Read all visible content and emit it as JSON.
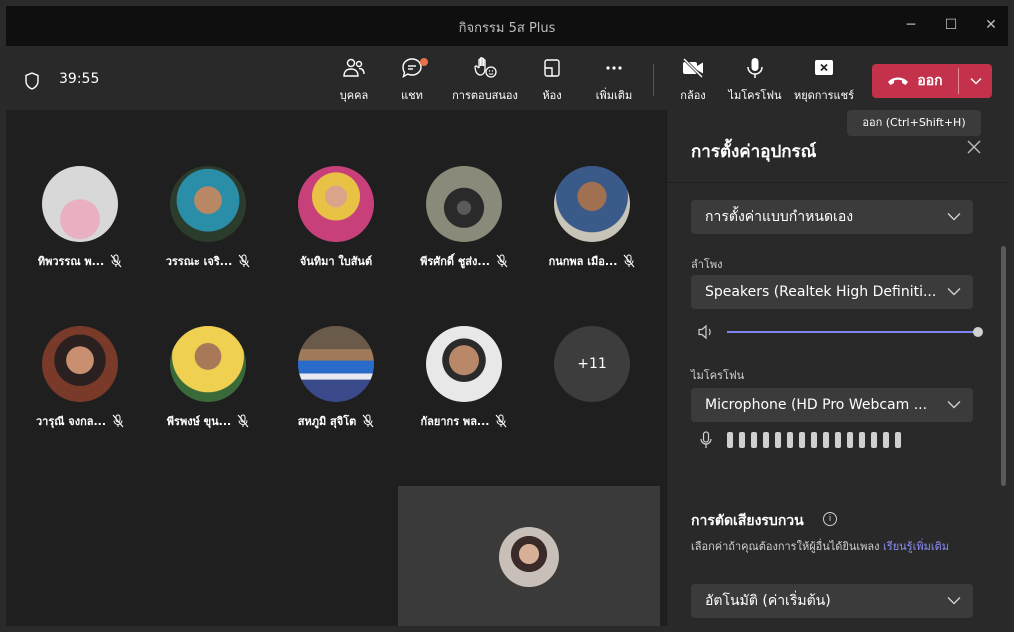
{
  "window": {
    "title": "กิจกรรม 5ส Plus"
  },
  "toolbar": {
    "timer": "39:55",
    "buttons": [
      {
        "label": "บุคคล",
        "icon": "people-icon"
      },
      {
        "label": "แชท",
        "icon": "chat-icon"
      },
      {
        "label": "การตอบสนอง",
        "icon": "reactions-icon"
      },
      {
        "label": "ห้อง",
        "icon": "rooms-icon"
      },
      {
        "label": "เพิ่มเติม",
        "icon": "more-icon"
      },
      {
        "label": "กล้อง",
        "icon": "camera-off-icon"
      },
      {
        "label": "ไมโครโฟน",
        "icon": "microphone-icon"
      },
      {
        "label": "หยุดการแชร์",
        "icon": "stop-share-icon"
      }
    ],
    "leave_label": "ออก",
    "leave_tooltip": "ออก (Ctrl+Shift+H)"
  },
  "participants": [
    {
      "name": "ทิพวรรณ พ...",
      "muted": true
    },
    {
      "name": "วรรณะ เจริ...",
      "muted": true
    },
    {
      "name": "จันทิมา ใบสันต์",
      "muted": false
    },
    {
      "name": "พีรศักดิ์ ชูส่ง...",
      "muted": true
    },
    {
      "name": "กนกพล เมือ...",
      "muted": true
    },
    {
      "name": "วารุณี จงกล...",
      "muted": true
    },
    {
      "name": "พีรพงษ์ ขุน...",
      "muted": true
    },
    {
      "name": "สหภูมิ สุจิโต",
      "muted": true
    },
    {
      "name": "กัลยากร พล...",
      "muted": true
    }
  ],
  "overflow_count": "+11",
  "device_panel": {
    "title": "การตั้งค่าอุปกรณ์",
    "preset": "การตั้งค่าแบบกำหนดเอง",
    "speaker_label": "ลำโพง",
    "speaker_value": "Speakers (Realtek High Definiti...",
    "speaker_volume": 1.0,
    "mic_label": "ไมโครโฟน",
    "mic_value": "Microphone (HD Pro Webcam ...",
    "noise_title": "การตัดเสียงรบกวน",
    "noise_desc": "เลือกค่าถ้าคุณต้องการให้ผู้อื่นได้ยินเพลง ",
    "noise_link": "เรียนรู้เพิ่มเติม",
    "noise_value": "อัตโนมัติ (ค่าเริ่มต้น)"
  },
  "colors": {
    "leave": "#c4314b",
    "accent": "#7f85f5",
    "badge": "#e8714b"
  }
}
